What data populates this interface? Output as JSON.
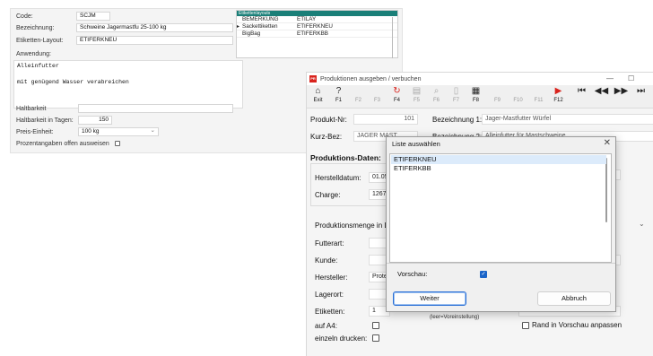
{
  "background_form": {
    "code_label": "Code:",
    "code_value": "SCJM",
    "bezeichnung_label": "Bezeichnung:",
    "bezeichnung_value": "Schweine Jagermastfu 25-100 kg",
    "layout_label": "Etiketten-Layout:",
    "layout_value": "ETIFERKNEU",
    "anwendung_label": "Anwendung:",
    "anwendung_lines": [
      "Alleinfutter",
      "",
      "mit genügend Wasser verabreichen"
    ],
    "haltbarkeit_label": "Haltbarkeit",
    "haltbarkeit_tage_label": "Haltbarkeit in Tagen:",
    "haltbarkeit_tage_value": "150",
    "preis_einheit_label": "Preis-Einheit:",
    "preis_einheit_value": "100 kg",
    "prozent_label": "Prozentangaben offen ausweisen",
    "grid": {
      "header": "Etikettenlayouts",
      "rows": [
        {
          "marker": "",
          "col1": "BEMERKUNG",
          "col2": "ETILAY"
        },
        {
          "marker": "▸",
          "col1": "Sackettiketten",
          "col2": "ETIFERKNEU"
        },
        {
          "marker": "",
          "col1": "BigBag",
          "col2": "ETIFERKBB"
        }
      ]
    }
  },
  "main_window": {
    "title": "Produktionen ausgeben / verbuchen",
    "app_icon_text": "PR",
    "minimize_glyph": "—",
    "maximize_glyph": "☐",
    "toolbar": [
      {
        "label": "Exit",
        "glyph": "⌂",
        "active": true
      },
      {
        "label": "F1",
        "glyph": "?",
        "active": true
      },
      {
        "label": "F2",
        "glyph": "",
        "active": false
      },
      {
        "label": "F3",
        "glyph": "",
        "active": false
      },
      {
        "label": "F4",
        "glyph": "↻",
        "active": true
      },
      {
        "label": "F5",
        "glyph": "▤",
        "active": false
      },
      {
        "label": "F6",
        "glyph": "⌕",
        "active": false
      },
      {
        "label": "F7",
        "glyph": "▯",
        "active": false
      },
      {
        "label": "F8",
        "glyph": "▦",
        "active": true
      },
      {
        "label": "F9",
        "glyph": "",
        "active": false
      },
      {
        "label": "F10",
        "glyph": "",
        "active": false
      },
      {
        "label": "F11",
        "glyph": "",
        "active": false
      },
      {
        "label": "F12",
        "glyph": "▶",
        "active": true
      },
      {
        "label": "",
        "glyph": "⏮",
        "active": true
      },
      {
        "label": "",
        "glyph": "◀◀",
        "active": true
      },
      {
        "label": "",
        "glyph": "▶▶",
        "active": true
      },
      {
        "label": "",
        "glyph": "⏭",
        "active": true
      }
    ],
    "produkt_nr_label": "Produkt-Nr:",
    "produkt_nr_value": "101",
    "bezeichnung1_label": "Bezeichnung 1:",
    "bezeichnung1_value": "Jager-Mastfutter Würfel",
    "kurz_bez_label": "Kurz-Bez:",
    "kurz_bez_value": "JAGER MAST",
    "bezeichnung2_label": "Bezeichnung 2:",
    "bezeichnung2_value": "Alleinfutter für Mastschweine",
    "produktions_daten_title": "Produktions-Daten:",
    "herstelldatum_label": "Herstelldatum:",
    "herstelldatum_value": "01.05",
    "charge_label": "Charge:",
    "charge_value": "1267",
    "produktionsmenge_label": "Produktionsmenge in Li",
    "futterart_label": "Futterart:",
    "kunde_label": "Kunde:",
    "hersteller_label": "Hersteller:",
    "hersteller_value": "Prote",
    "lagerort_label": "Lagerort:",
    "etiketten_label": "Etiketten:",
    "etiketten_value": "1",
    "leer_hint": "(leer=Voreinstellung)",
    "auf_a4_label": "auf A4:",
    "einzeln_label": "einzeln drucken:",
    "rand_label": "Rand in Vorschau anpassen",
    "dropdown_glyph": "⌄"
  },
  "dialog": {
    "title": "Liste auswählen",
    "close_glyph": "✕",
    "items": [
      "ETIFERKNEU",
      "ETIFERKBB"
    ],
    "selected_index": 0,
    "vorschau_label": "Vorschau:",
    "vorschau_checked": true,
    "check_glyph": "✓",
    "weiter_label": "Weiter",
    "abbruch_label": "Abbruch"
  },
  "colors": {
    "grid_header": "#1a7f78",
    "app_icon": "#d9231d",
    "checkbox_checked": "#1a64c8",
    "list_selection": "#dcebfb",
    "primary_button_border": "#2a6fd6"
  }
}
